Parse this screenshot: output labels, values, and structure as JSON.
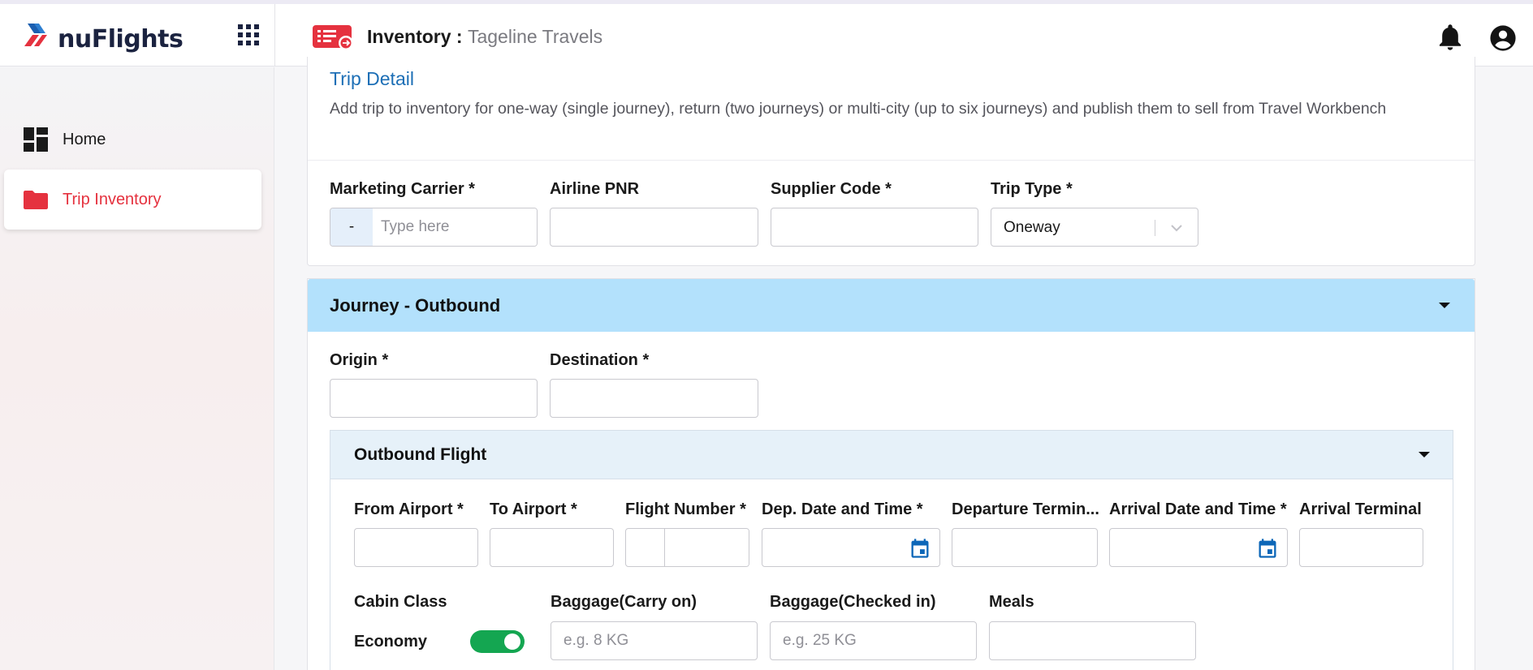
{
  "app": {
    "brand": "nuFlights",
    "page_title": "Inventory :",
    "page_subtitle": "Tageline Travels"
  },
  "sidebar": {
    "items": [
      {
        "label": "Home",
        "icon": "dashboard-icon",
        "active": false
      },
      {
        "label": "Trip Inventory",
        "icon": "folder-icon",
        "active": true
      }
    ]
  },
  "trip_detail": {
    "title": "Trip Detail",
    "description": "Add trip to inventory for one-way (single journey), return (two journeys) or multi-city (up to six journeys) and publish them to sell from Travel Workbench",
    "marketing_carrier": {
      "label": "Marketing Carrier *",
      "prefix": "-",
      "placeholder": "Type here",
      "value": ""
    },
    "airline_pnr": {
      "label": "Airline PNR",
      "value": ""
    },
    "supplier_code": {
      "label": "Supplier Code *",
      "value": ""
    },
    "trip_type": {
      "label": "Trip Type *",
      "value": "Oneway"
    }
  },
  "journey": {
    "title": "Journey - Outbound",
    "origin": {
      "label": "Origin *",
      "value": ""
    },
    "destination": {
      "label": "Destination *",
      "value": ""
    },
    "flight": {
      "title": "Outbound Flight",
      "from_airport": {
        "label": "From Airport *",
        "value": ""
      },
      "to_airport": {
        "label": "To Airport *",
        "value": ""
      },
      "flight_number": {
        "label": "Flight Number *",
        "value": ""
      },
      "dep_datetime": {
        "label": "Dep. Date and Time *",
        "value": ""
      },
      "departure_terminal": {
        "label": "Departure Termin...",
        "value": ""
      },
      "arr_datetime": {
        "label": "Arrival Date and Time *",
        "value": ""
      },
      "arrival_terminal": {
        "label": "Arrival Terminal",
        "value": ""
      },
      "cabin_class": {
        "label": "Cabin Class",
        "value": "Economy",
        "enabled": true
      },
      "baggage_carry_on": {
        "label": "Baggage(Carry on)",
        "placeholder": "e.g. 8 KG",
        "value": ""
      },
      "baggage_checked_in": {
        "label": "Baggage(Checked in)",
        "placeholder": "e.g. 25 KG",
        "value": ""
      },
      "meals": {
        "label": "Meals",
        "value": ""
      }
    }
  },
  "colors": {
    "brand_red": "#e5323f",
    "brand_navy": "#1b2340",
    "link_blue": "#1d6fb6",
    "journey_header": "#b3e1fc",
    "flight_header": "#e6f1f9",
    "toggle_on": "#14a651"
  }
}
